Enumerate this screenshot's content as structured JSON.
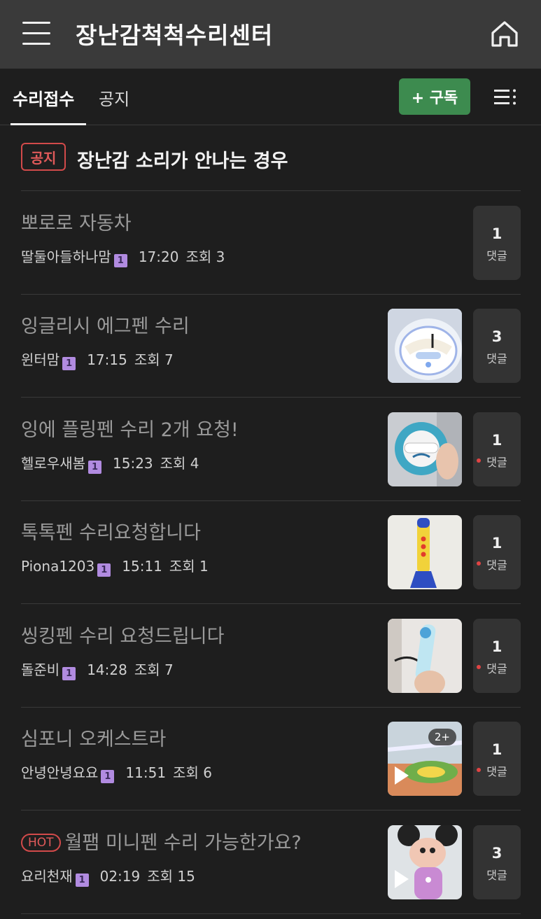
{
  "header": {
    "title": "장난감척척수리센터"
  },
  "tabs": [
    {
      "label": "수리접수"
    },
    {
      "label": "공지"
    }
  ],
  "subscribe_label": "+ 구독",
  "notice": {
    "badge": "공지",
    "text": "장난감 소리가 안나는 경우"
  },
  "posts": [
    {
      "title": "뽀로로 자동차",
      "hot": "",
      "author": "딸둘아들하나맘",
      "level": "1",
      "time": "17:20",
      "views": "조회 3",
      "comments": "1",
      "comment_label": "댓글",
      "thumb": "none"
    },
    {
      "title": "잉글리시 에그펜 수리",
      "hot": "",
      "author": "윈터맘",
      "level": "1",
      "time": "17:15",
      "views": "조회 7",
      "comments": "3",
      "comment_label": "댓글",
      "thumb": "egg-device"
    },
    {
      "title": "잉에 플링펜 수리 2개 요청!",
      "hot": "",
      "author": "헬로우새봄",
      "level": "1",
      "time": "15:23",
      "views": "조회 4",
      "comments": "1",
      "comment_label": "댓글",
      "thumb": "blue-device"
    },
    {
      "title": "톡톡펜 수리요청합니다",
      "hot": "",
      "author": "Piona1203",
      "level": "1",
      "time": "15:11",
      "views": "조회 1",
      "comments": "1",
      "comment_label": "댓글",
      "thumb": "talking-pen"
    },
    {
      "title": "씽킹펜 수리 요청드립니다",
      "hot": "",
      "author": "돌준비",
      "level": "1",
      "time": "14:28",
      "views": "조회 7",
      "comments": "1",
      "comment_label": "댓글",
      "thumb": "thinking-pen"
    },
    {
      "title": "심포니 오케스트라",
      "hot": "",
      "author": "안녕안녕요요",
      "level": "1",
      "time": "11:51",
      "views": "조회 6",
      "comments": "1",
      "comment_label": "댓글",
      "thumb": "orchestra-toy",
      "more": "2+"
    },
    {
      "title": "월팸 미니펜 수리 가능한가요?",
      "hot": "HOT",
      "author": "요리천재",
      "level": "1",
      "time": "02:19",
      "views": "조회 15",
      "comments": "3",
      "comment_label": "댓글",
      "thumb": "minnie-toy"
    }
  ]
}
